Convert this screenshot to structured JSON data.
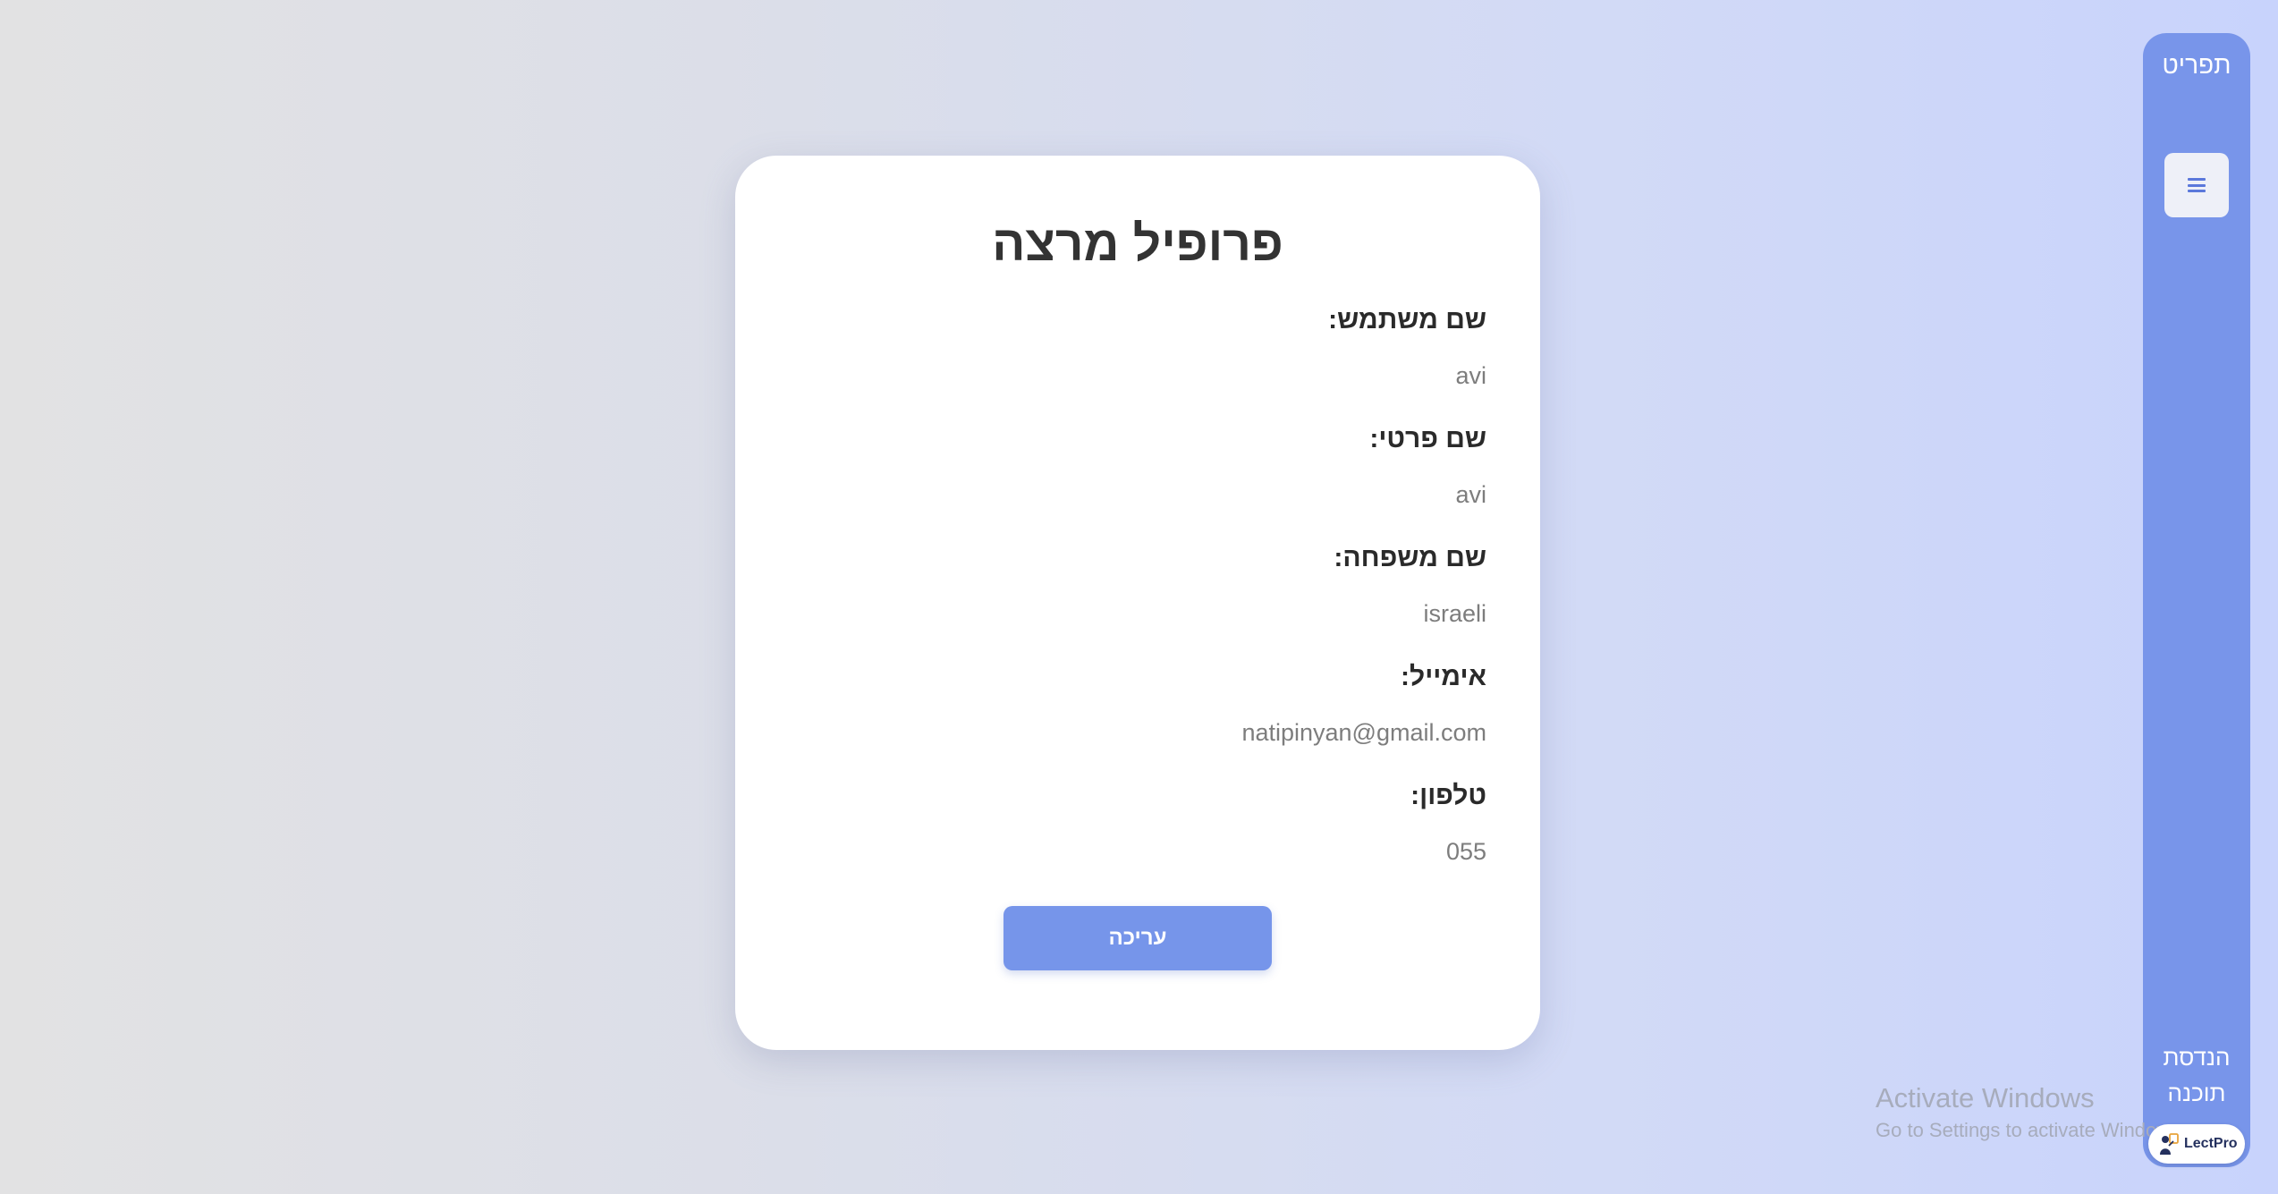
{
  "profile": {
    "title": "פרופיל מרצה",
    "fields": [
      {
        "label": "שם משתמש:",
        "value": "avi"
      },
      {
        "label": "שם פרטי:",
        "value": "avi"
      },
      {
        "label": "שם משפחה:",
        "value": "israeli"
      },
      {
        "label": "אימייל:",
        "value": "natipinyan@gmail.com"
      },
      {
        "label": "טלפון:",
        "value": "055"
      }
    ],
    "edit_label": "עריכה"
  },
  "sidebar": {
    "brand": "תפריט",
    "menu_icon": "hamburger-menu-icon",
    "footer_line1": "הנדסת",
    "footer_line2": "תוכנה",
    "color": "#7895ea"
  },
  "watermark": {
    "title": "Activate Windows",
    "subtitle": "Go to Settings to activate Windows."
  },
  "badge": {
    "text": "LectPro",
    "icon": "lectpro-logo-icon"
  },
  "colors": {
    "accent": "#7695ea",
    "card": "#ffffff",
    "text_dark": "#333333",
    "text_muted": "#7d7d7d"
  }
}
